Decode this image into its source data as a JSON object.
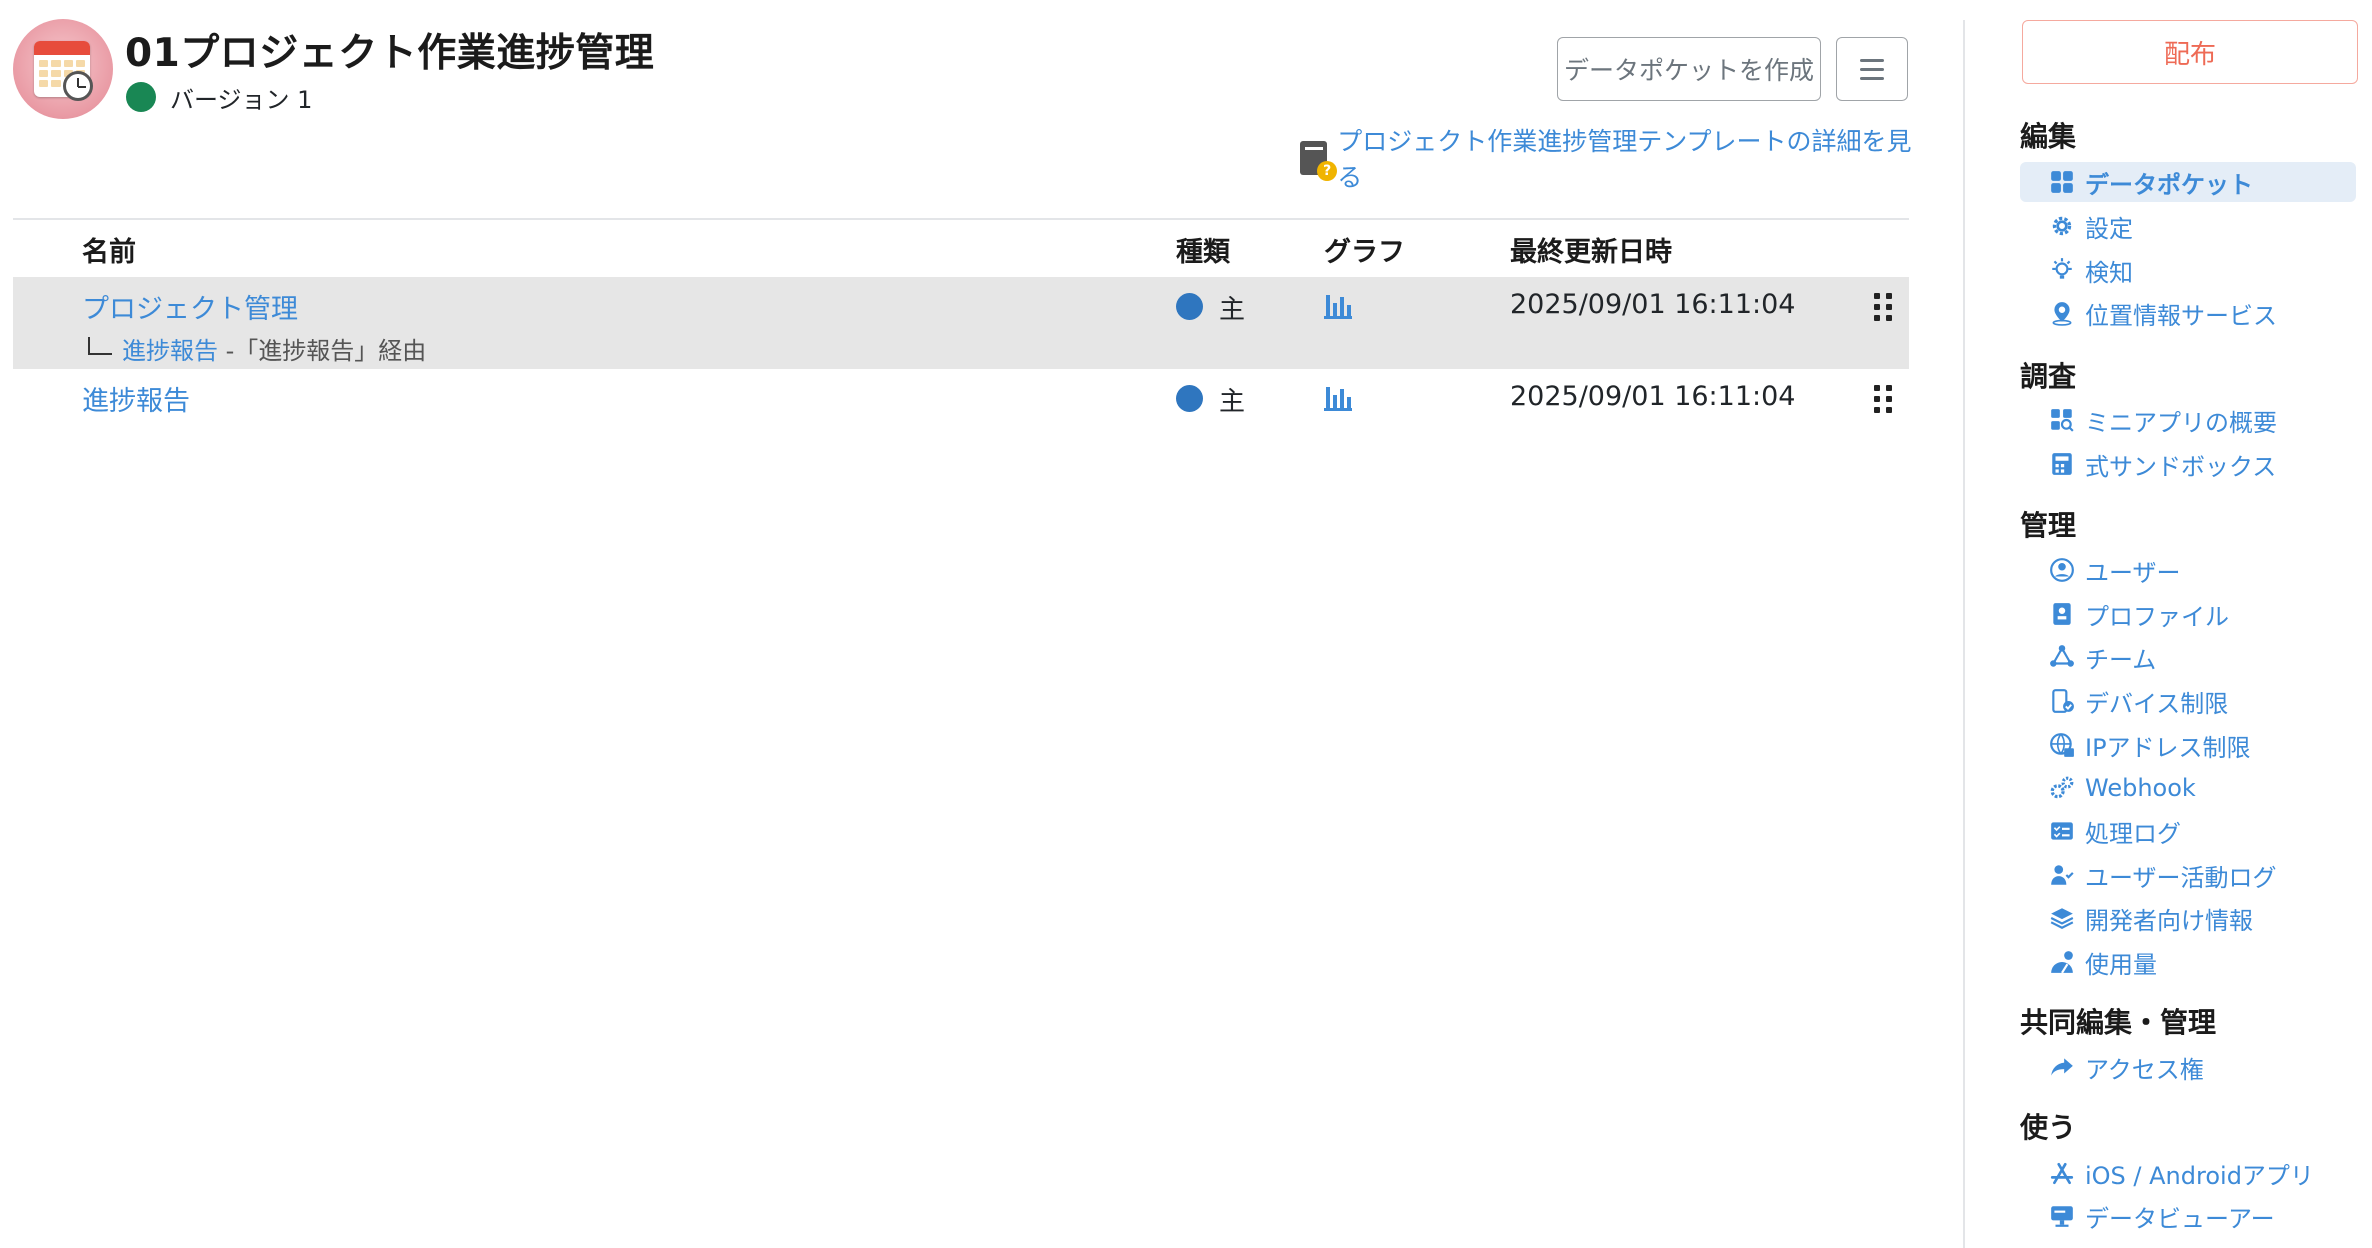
{
  "header": {
    "title": "01プロジェクト作業進捗管理",
    "version": "バージョン 1",
    "create_button": "データポケットを作成",
    "template_link": "プロジェクト作業進捗管理テンプレートの詳細を見る"
  },
  "colors": {
    "accent": "#3d8ad7",
    "version_status": "#198754",
    "kind_dot": "#2f76bf",
    "deploy": "#ee6a55"
  },
  "table": {
    "headers": {
      "name": "名前",
      "kind": "種類",
      "graph": "グラフ",
      "updated": "最終更新日時"
    },
    "rows": [
      {
        "name": "プロジェクト管理",
        "sub_link": "進捗報告",
        "sub_suffix": " -「進捗報告」経由",
        "kind": "主",
        "updated": "2025/09/01 16:11:04"
      },
      {
        "name": "進捗報告",
        "kind": "主",
        "updated": "2025/09/01 16:11:04"
      }
    ]
  },
  "sidebar": {
    "deploy": "配布",
    "sections": [
      {
        "title": "編集",
        "items": [
          {
            "label": "データポケット",
            "icon": "grid-icon",
            "active": true
          },
          {
            "label": "設定",
            "icon": "gear-icon"
          },
          {
            "label": "検知",
            "icon": "bulb-icon"
          },
          {
            "label": "位置情報サービス",
            "icon": "location-icon"
          }
        ]
      },
      {
        "title": "調査",
        "items": [
          {
            "label": "ミニアプリの概要",
            "icon": "grid-search-icon"
          },
          {
            "label": "式サンドボックス",
            "icon": "calculator-icon"
          }
        ]
      },
      {
        "title": "管理",
        "items": [
          {
            "label": "ユーザー",
            "icon": "user-circle-icon"
          },
          {
            "label": "プロファイル",
            "icon": "profile-card-icon"
          },
          {
            "label": "チーム",
            "icon": "team-icon"
          },
          {
            "label": "デバイス制限",
            "icon": "device-check-icon"
          },
          {
            "label": "IPアドレス制限",
            "icon": "globe-lock-icon"
          },
          {
            "label": "Webhook",
            "icon": "gears-icon"
          },
          {
            "label": "処理ログ",
            "icon": "log-icon"
          },
          {
            "label": "ユーザー活動ログ",
            "icon": "user-activity-icon"
          },
          {
            "label": "開発者向け情報",
            "icon": "layers-icon"
          },
          {
            "label": "使用量",
            "icon": "usage-icon"
          }
        ]
      },
      {
        "title": "共同編集・管理",
        "items": [
          {
            "label": "アクセス権",
            "icon": "share-icon"
          }
        ]
      },
      {
        "title": "使う",
        "items": [
          {
            "label": "iOS / Androidアプリ",
            "icon": "app-store-icon"
          },
          {
            "label": "データビューアー",
            "icon": "monitor-icon"
          }
        ]
      }
    ]
  }
}
